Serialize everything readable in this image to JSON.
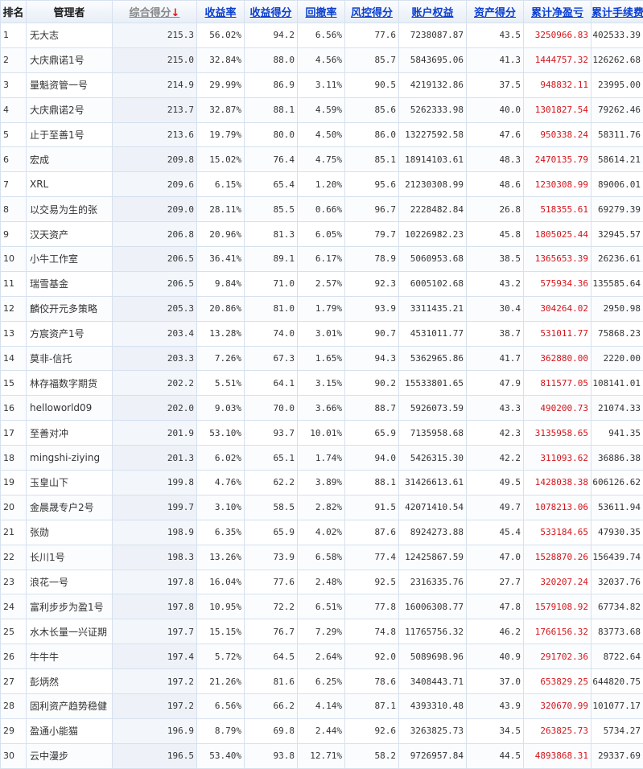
{
  "headers": {
    "rank": "排名",
    "manager": "管理者",
    "total_score": "综合得分",
    "sort_arrow": "↓",
    "return_rate": "收益率",
    "return_score": "收益得分",
    "drawdown": "回撤率",
    "risk_score": "风控得分",
    "equity": "账户权益",
    "asset_score": "资产得分",
    "net_pnl": "累计净盈亏",
    "fees": "累计手续费"
  },
  "rows": [
    [
      "1",
      "无大志",
      "215.3",
      "56.02%",
      "94.2",
      "6.56%",
      "77.6",
      "7238087.87",
      "43.5",
      "3250966.83",
      "402533.39"
    ],
    [
      "2",
      "大庆鼎诺1号",
      "215.0",
      "32.84%",
      "88.0",
      "4.56%",
      "85.7",
      "5843695.06",
      "41.3",
      "1444757.32",
      "126262.68"
    ],
    [
      "3",
      "量魁资管一号",
      "214.9",
      "29.99%",
      "86.9",
      "3.11%",
      "90.5",
      "4219132.86",
      "37.5",
      "948832.11",
      "23995.00"
    ],
    [
      "4",
      "大庆鼎诺2号",
      "213.7",
      "32.87%",
      "88.1",
      "4.59%",
      "85.6",
      "5262333.98",
      "40.0",
      "1301827.54",
      "79262.46"
    ],
    [
      "5",
      "止于至善1号",
      "213.6",
      "19.79%",
      "80.0",
      "4.50%",
      "86.0",
      "13227592.58",
      "47.6",
      "950338.24",
      "58311.76"
    ],
    [
      "6",
      "宏成",
      "209.8",
      "15.02%",
      "76.4",
      "4.75%",
      "85.1",
      "18914103.61",
      "48.3",
      "2470135.79",
      "58614.21"
    ],
    [
      "7",
      "XRL",
      "209.6",
      "6.15%",
      "65.4",
      "1.20%",
      "95.6",
      "21230308.99",
      "48.6",
      "1230308.99",
      "89006.01"
    ],
    [
      "8",
      "以交易为生的张",
      "209.0",
      "28.11%",
      "85.5",
      "0.66%",
      "96.7",
      "2228482.84",
      "26.8",
      "518355.61",
      "69279.39"
    ],
    [
      "9",
      "汉天资产",
      "206.8",
      "20.96%",
      "81.3",
      "6.05%",
      "79.7",
      "10226982.23",
      "45.8",
      "1805025.44",
      "32945.57"
    ],
    [
      "10",
      "小牛工作室",
      "206.5",
      "36.41%",
      "89.1",
      "6.17%",
      "78.9",
      "5060953.68",
      "38.5",
      "1365653.39",
      "26236.61"
    ],
    [
      "11",
      "瑞雪基金",
      "206.5",
      "9.84%",
      "71.0",
      "2.57%",
      "92.3",
      "6005102.68",
      "43.2",
      "575934.36",
      "135585.64"
    ],
    [
      "12",
      "麟佼开元多策略",
      "205.3",
      "20.86%",
      "81.0",
      "1.79%",
      "93.9",
      "3311435.21",
      "30.4",
      "304264.02",
      "2950.98"
    ],
    [
      "13",
      "方宸资产1号",
      "203.4",
      "13.28%",
      "74.0",
      "3.01%",
      "90.7",
      "4531011.77",
      "38.7",
      "531011.77",
      "75868.23"
    ],
    [
      "14",
      "莫非-信托",
      "203.3",
      "7.26%",
      "67.3",
      "1.65%",
      "94.3",
      "5362965.86",
      "41.7",
      "362880.00",
      "2220.00"
    ],
    [
      "15",
      "林存福数字期货",
      "202.2",
      "5.51%",
      "64.1",
      "3.15%",
      "90.2",
      "15533801.65",
      "47.9",
      "811577.05",
      "108141.01"
    ],
    [
      "16",
      "helloworld09",
      "202.0",
      "9.03%",
      "70.0",
      "3.66%",
      "88.7",
      "5926073.59",
      "43.3",
      "490200.73",
      "21074.33"
    ],
    [
      "17",
      "至善对冲",
      "201.9",
      "53.10%",
      "93.7",
      "10.01%",
      "65.9",
      "7135958.68",
      "42.3",
      "3135958.65",
      "941.35"
    ],
    [
      "18",
      "mingshi-ziying",
      "201.3",
      "6.02%",
      "65.1",
      "1.74%",
      "94.0",
      "5426315.30",
      "42.2",
      "311093.62",
      "36886.38"
    ],
    [
      "19",
      "玉皇山下",
      "199.8",
      "4.76%",
      "62.2",
      "3.89%",
      "88.1",
      "31426613.61",
      "49.5",
      "1428038.38",
      "606126.62"
    ],
    [
      "20",
      "金晨晟专户2号",
      "199.7",
      "3.10%",
      "58.5",
      "2.82%",
      "91.5",
      "42071410.54",
      "49.7",
      "1078213.06",
      "53611.94"
    ],
    [
      "21",
      "张勋",
      "198.9",
      "6.35%",
      "65.9",
      "4.02%",
      "87.6",
      "8924273.88",
      "45.4",
      "533184.65",
      "47930.35"
    ],
    [
      "22",
      "长川1号",
      "198.3",
      "13.26%",
      "73.9",
      "6.58%",
      "77.4",
      "12425867.59",
      "47.0",
      "1528870.26",
      "156439.74"
    ],
    [
      "23",
      "浪花一号",
      "197.8",
      "16.04%",
      "77.6",
      "2.48%",
      "92.5",
      "2316335.76",
      "27.7",
      "320207.24",
      "32037.76"
    ],
    [
      "24",
      "富利步步为盈1号",
      "197.8",
      "10.95%",
      "72.2",
      "6.51%",
      "77.8",
      "16006308.77",
      "47.8",
      "1579108.92",
      "67734.82"
    ],
    [
      "25",
      "水木长量一兴证期",
      "197.7",
      "15.15%",
      "76.7",
      "7.29%",
      "74.8",
      "11765756.32",
      "46.2",
      "1766156.32",
      "83773.68"
    ],
    [
      "26",
      "牛牛牛",
      "197.4",
      "5.72%",
      "64.5",
      "2.64%",
      "92.0",
      "5089698.96",
      "40.9",
      "291702.36",
      "8722.64"
    ],
    [
      "27",
      "彭炳然",
      "197.2",
      "21.26%",
      "81.6",
      "6.25%",
      "78.6",
      "3408443.71",
      "37.0",
      "653829.25",
      "644820.75"
    ],
    [
      "28",
      "固利资产趋势稳健",
      "197.2",
      "6.56%",
      "66.2",
      "4.14%",
      "87.1",
      "4393310.48",
      "43.9",
      "320670.99",
      "101077.17"
    ],
    [
      "29",
      "盈通小能猫",
      "196.9",
      "8.79%",
      "69.8",
      "2.44%",
      "92.6",
      "3263825.73",
      "34.5",
      "263825.73",
      "5734.27"
    ],
    [
      "30",
      "云中漫步",
      "196.5",
      "53.40%",
      "93.8",
      "12.71%",
      "58.2",
      "9726957.84",
      "44.5",
      "4893868.31",
      "29337.69"
    ]
  ]
}
